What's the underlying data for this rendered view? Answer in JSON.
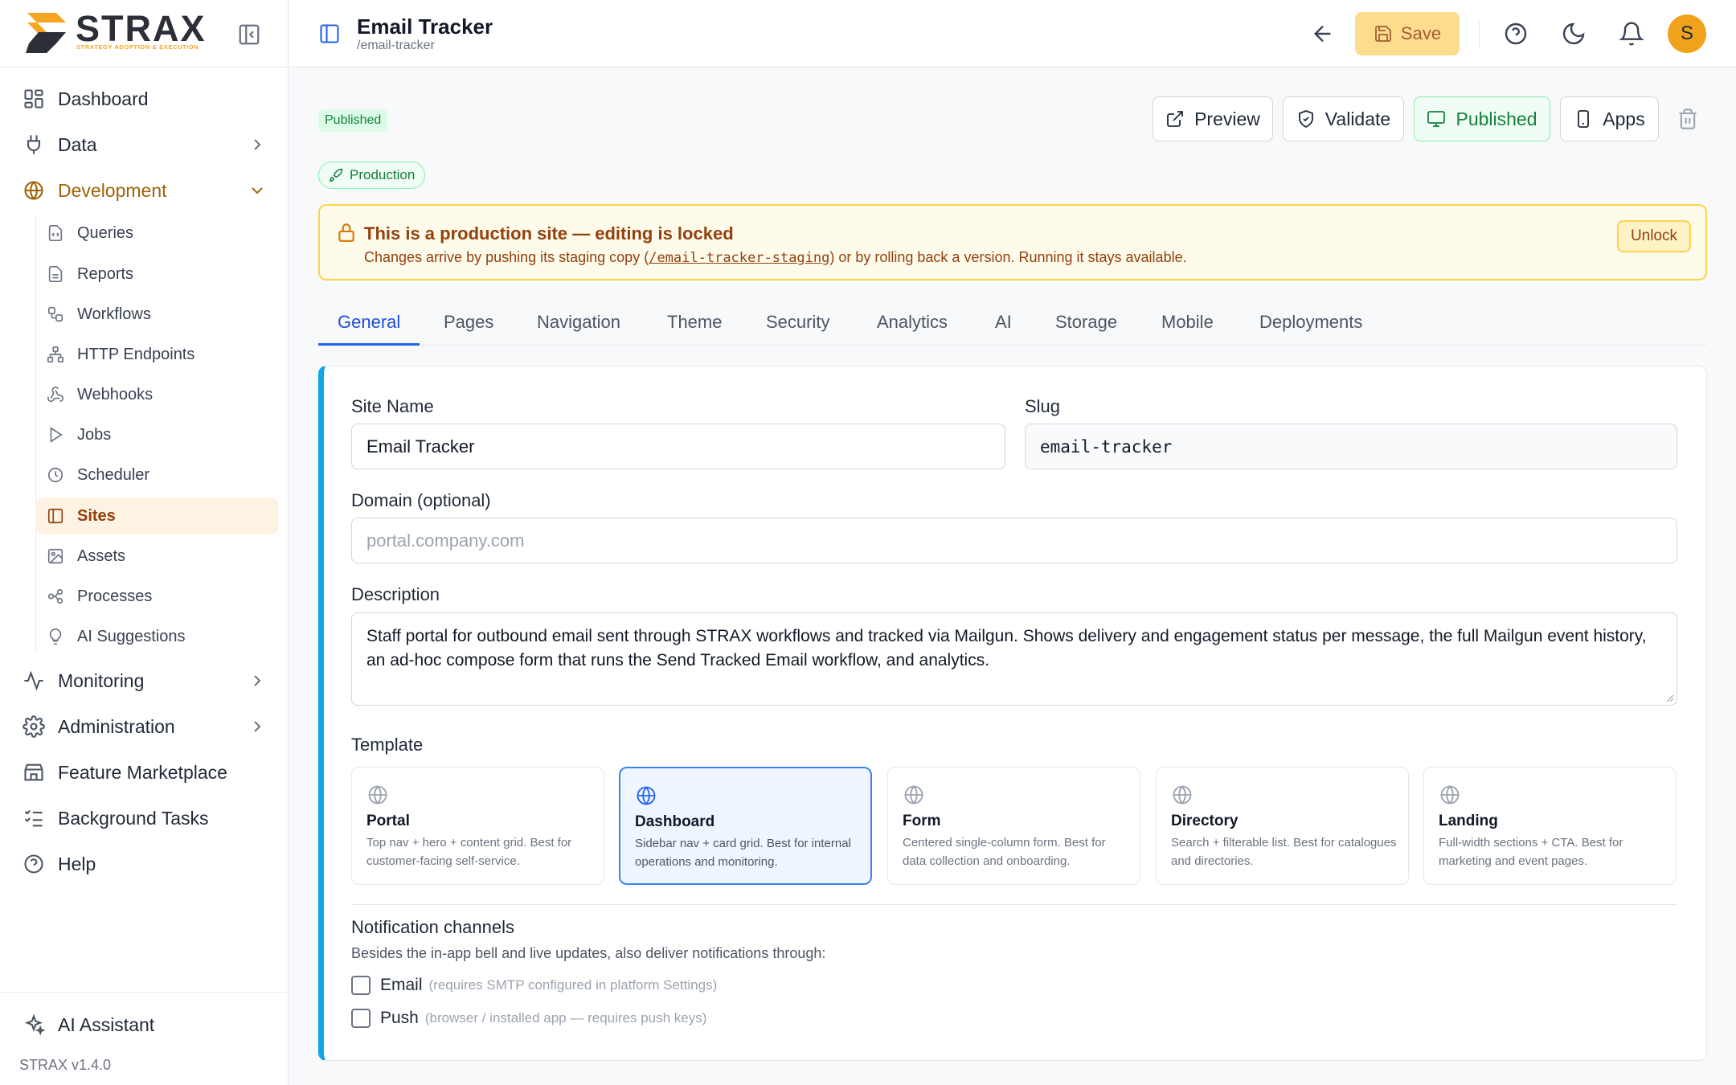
{
  "app": {
    "brand": "STRAX",
    "tagline": "STRATEGY ADOPTION & EXECUTION",
    "version": "STRAX v1.4.0",
    "accent_color": "#f0a21a"
  },
  "sidebar": {
    "items": [
      {
        "label": "Dashboard",
        "icon": "grid-icon"
      },
      {
        "label": "Data",
        "icon": "plug-icon"
      },
      {
        "label": "Development",
        "icon": "globe-icon"
      },
      {
        "label": "Monitoring",
        "icon": "activity-icon"
      },
      {
        "label": "Administration",
        "icon": "gear-icon"
      },
      {
        "label": "Feature Marketplace",
        "icon": "store-icon"
      },
      {
        "label": "Background Tasks",
        "icon": "list-checks-icon"
      },
      {
        "label": "Help",
        "icon": "help-circle-icon"
      }
    ],
    "sub_items": [
      {
        "label": "Queries",
        "icon": "file-code-icon"
      },
      {
        "label": "Reports",
        "icon": "file-text-icon"
      },
      {
        "label": "Workflows",
        "icon": "workflow-icon"
      },
      {
        "label": "HTTP Endpoints",
        "icon": "network-icon"
      },
      {
        "label": "Webhooks",
        "icon": "webhook-icon"
      },
      {
        "label": "Jobs",
        "icon": "play-icon"
      },
      {
        "label": "Scheduler",
        "icon": "clock-icon"
      },
      {
        "label": "Sites",
        "icon": "panel-icon"
      },
      {
        "label": "Assets",
        "icon": "image-icon"
      },
      {
        "label": "Processes",
        "icon": "process-icon"
      },
      {
        "label": "AI Suggestions",
        "icon": "lightbulb-icon"
      }
    ],
    "ai_assistant": "AI Assistant"
  },
  "header": {
    "title": "Email Tracker",
    "path": "/email-tracker",
    "save_label": "Save",
    "avatar_initial": "S"
  },
  "status": {
    "published_badge": "Published",
    "environment_badge": "Production"
  },
  "actions": {
    "preview": "Preview",
    "validate": "Validate",
    "published": "Published",
    "apps": "Apps"
  },
  "alert": {
    "title": "This is a production site — editing is locked",
    "text_before": "Changes arrive by pushing its staging copy (",
    "link": "/email-tracker-staging",
    "text_after": ") or by rolling back a version. Running it stays available.",
    "unlock": "Unlock"
  },
  "tabs": [
    "General",
    "Pages",
    "Navigation",
    "Theme",
    "Security",
    "Analytics",
    "AI",
    "Storage",
    "Mobile",
    "Deployments"
  ],
  "form": {
    "site_name_label": "Site Name",
    "site_name_value": "Email Tracker",
    "slug_label": "Slug",
    "slug_value": "email-tracker",
    "domain_label": "Domain (optional)",
    "domain_placeholder": "portal.company.com",
    "description_label": "Description",
    "description_value": "Staff portal for outbound email sent through STRAX workflows and tracked via Mailgun. Shows delivery and engagement status per message, the full Mailgun event history, an ad-hoc compose form that runs the Send Tracked Email workflow, and analytics.",
    "template_label": "Template",
    "templates": [
      {
        "name": "Portal",
        "desc": "Top nav + hero + content grid. Best for customer-facing self-service."
      },
      {
        "name": "Dashboard",
        "desc": "Sidebar nav + card grid. Best for internal operations and monitoring."
      },
      {
        "name": "Form",
        "desc": "Centered single-column form. Best for data collection and onboarding."
      },
      {
        "name": "Directory",
        "desc": "Search + filterable list. Best for catalogues and directories."
      },
      {
        "name": "Landing",
        "desc": "Full-width sections + CTA. Best for marketing and event pages."
      }
    ],
    "selected_template": "Dashboard",
    "notifications_title": "Notification channels",
    "notifications_sub": "Besides the in-app bell and live updates, also deliver notifications through:",
    "channels": [
      {
        "label": "Email",
        "hint": "(requires SMTP configured in platform Settings)",
        "checked": false
      },
      {
        "label": "Push",
        "hint": "(browser / installed app — requires push keys)",
        "checked": false
      }
    ]
  }
}
